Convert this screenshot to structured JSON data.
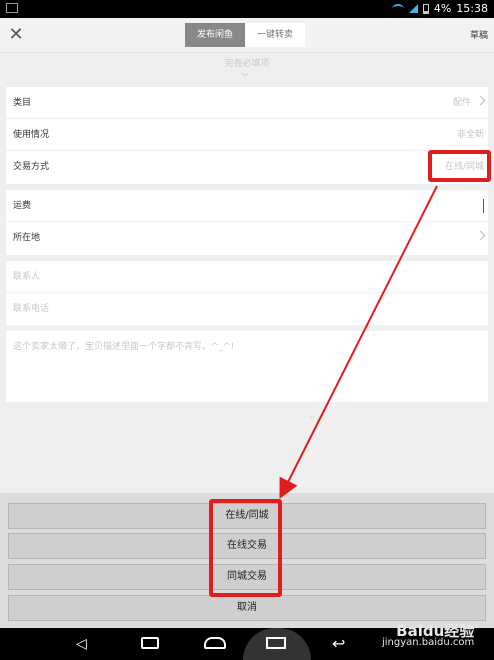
{
  "status": {
    "battery": "4%",
    "time": "15:38"
  },
  "header": {
    "tabs": [
      {
        "label": "发布闲鱼"
      },
      {
        "label": "一键转卖"
      }
    ],
    "draft_label": "草稿"
  },
  "hint": "完善必填项",
  "form1": [
    {
      "label": "类目",
      "value": "配件"
    },
    {
      "label": "使用情况",
      "value": "非全新"
    },
    {
      "label": "交易方式",
      "value": "在线/同城"
    }
  ],
  "form2": [
    {
      "label": "运费"
    },
    {
      "label": "所在地"
    }
  ],
  "contact": {
    "name_placeholder": "联系人",
    "phone_placeholder": "联系电话"
  },
  "description_placeholder": "这个卖家太懒了，宝贝描述里面一个字都不肯写。^_^!",
  "sheet": {
    "options": [
      {
        "label": "在线/同城"
      },
      {
        "label": "在线交易"
      },
      {
        "label": "同城交易"
      }
    ],
    "cancel_label": "取消"
  },
  "watermark": {
    "logo": "Baidu经验",
    "url": "jingyan.baidu.com"
  },
  "colors": {
    "highlight": "#e01e1e",
    "active_tab": "#888888"
  }
}
